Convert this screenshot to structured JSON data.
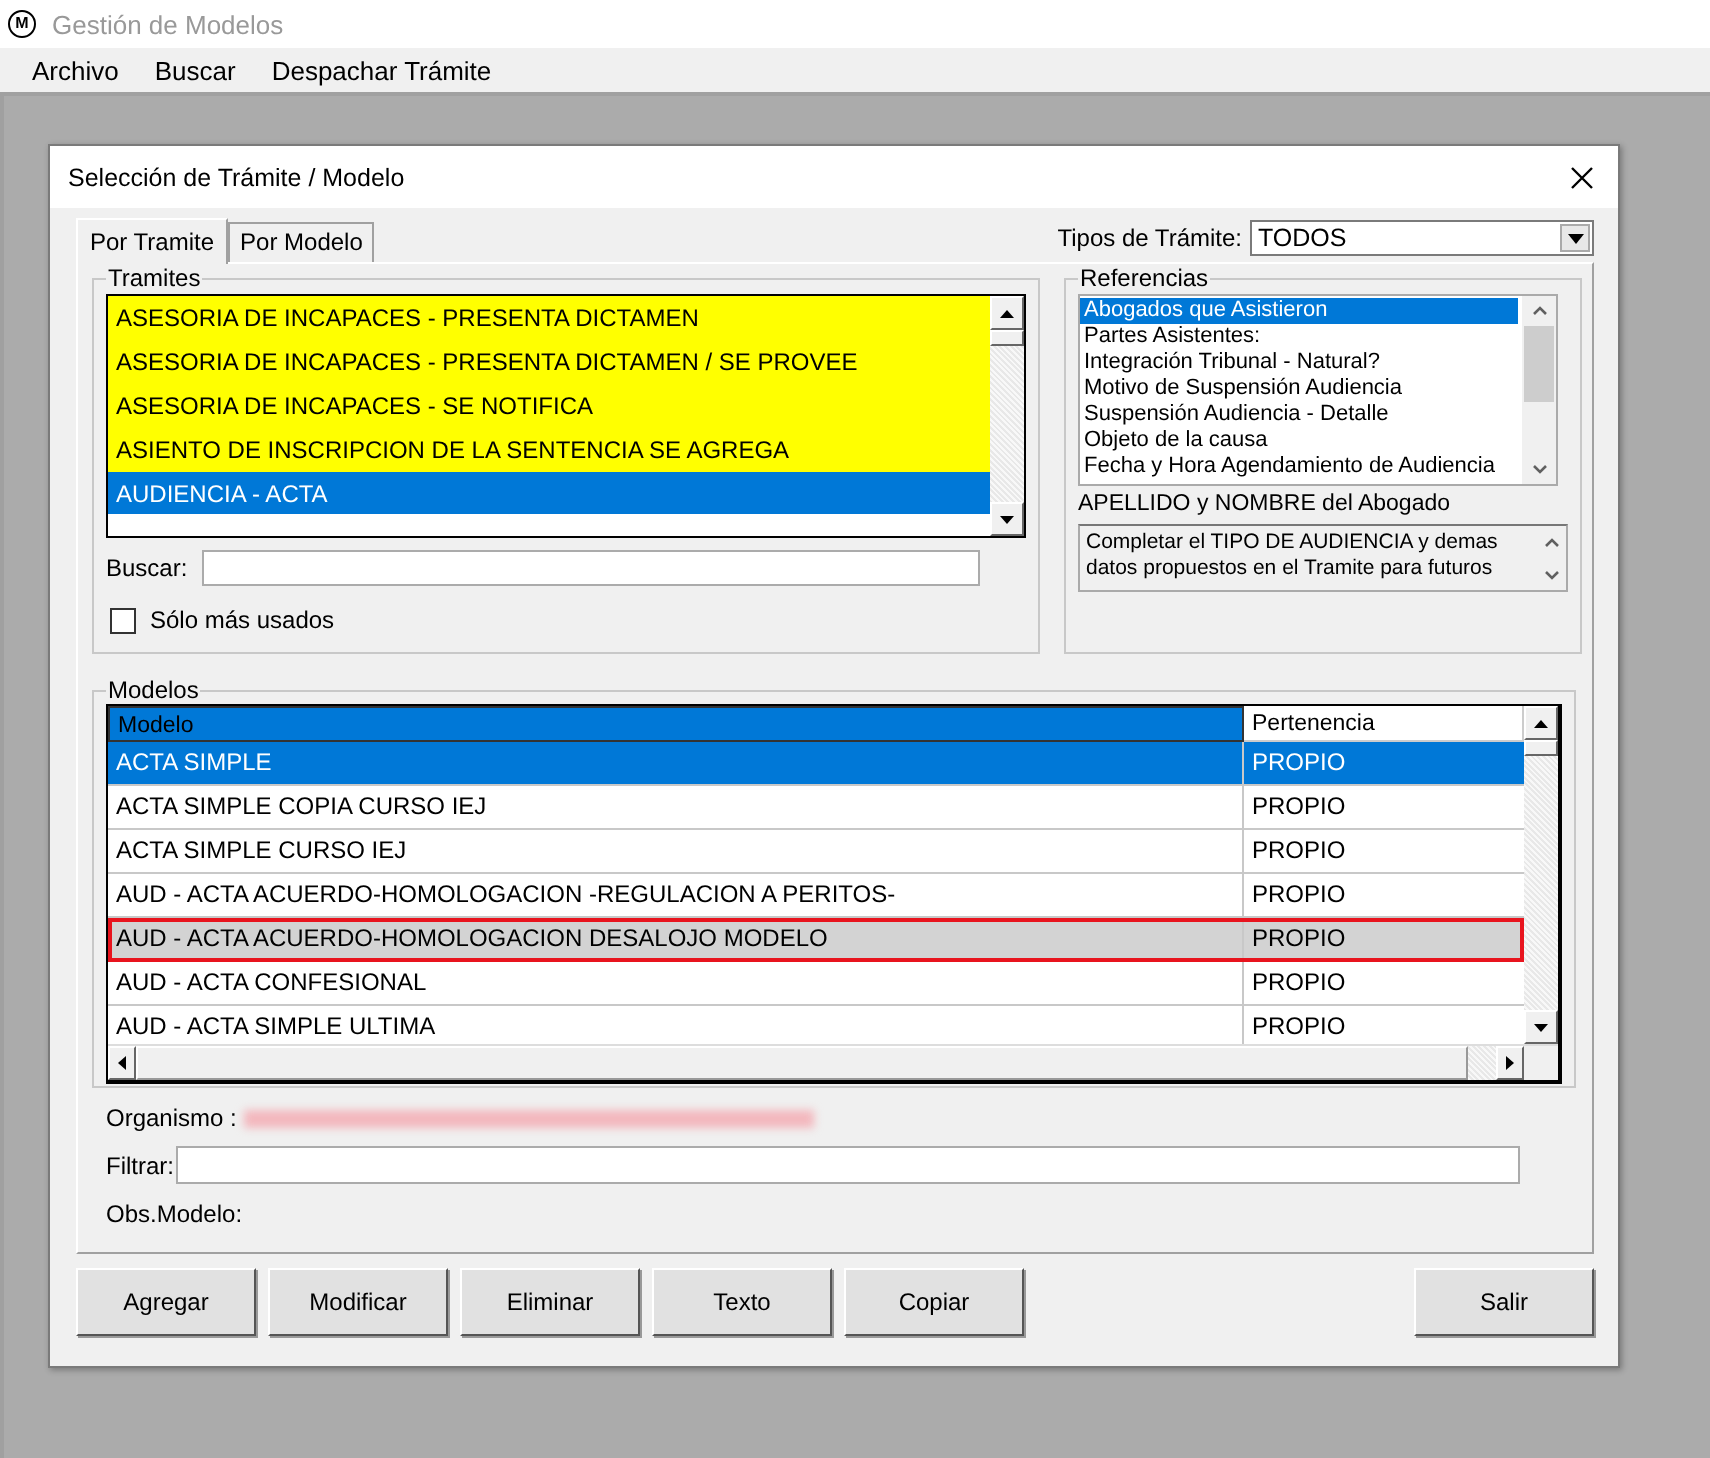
{
  "app": {
    "title": "Gestión de Modelos",
    "logo": "M"
  },
  "menu": [
    "Archivo",
    "Buscar",
    "Despachar Trámite"
  ],
  "dialog": {
    "title": "Selección de Trámite / Modelo"
  },
  "tabs": [
    {
      "label": "Por Tramite",
      "selected": true
    },
    {
      "label": "Por Modelo",
      "selected": false
    }
  ],
  "tipos": {
    "label": "Tipos de Trámite:",
    "value": "TODOS"
  },
  "tramites": {
    "title": "Tramites",
    "items": [
      {
        "label": "ASESORIA DE INCAPACES - PRESENTA DICTAMEN",
        "color": "#ffff00",
        "selected": false
      },
      {
        "label": "ASESORIA DE INCAPACES - PRESENTA DICTAMEN / SE PROVEE",
        "color": "#ffff00",
        "selected": false
      },
      {
        "label": "ASESORIA DE INCAPACES - SE NOTIFICA",
        "color": "#ffff00",
        "selected": false
      },
      {
        "label": "ASIENTO DE INSCRIPCION DE LA SENTENCIA SE AGREGA",
        "color": "#ffff00",
        "selected": false
      },
      {
        "label": "AUDIENCIA - ACTA",
        "color": "#ffffff",
        "selected": true
      }
    ],
    "search_label": "Buscar:",
    "only_used": {
      "label": "Sólo más usados",
      "checked": false
    }
  },
  "referencias": {
    "title": "Referencias",
    "items": [
      {
        "label": "Abogados que Asistieron",
        "selected": true
      },
      {
        "label": "Partes Asistentes:",
        "selected": false
      },
      {
        "label": "Integración Tribunal - Natural?",
        "selected": false
      },
      {
        "label": "Motivo de Suspensión Audiencia",
        "selected": false
      },
      {
        "label": "Suspensión Audiencia - Detalle",
        "selected": false
      },
      {
        "label": "Objeto de la causa",
        "selected": false
      },
      {
        "label": "Fecha y Hora Agendamiento de Audiencia",
        "selected": false
      }
    ],
    "field_label": "APELLIDO y NOMBRE del Abogado",
    "note_lines": [
      "Completar el TIPO DE AUDIENCIA y demas",
      "datos propuestos en el Tramite para futuros"
    ]
  },
  "modelos": {
    "title": "Modelos",
    "columns": [
      {
        "label": "Modelo",
        "selected": true
      },
      {
        "label": "Pertenencia",
        "selected": false
      }
    ],
    "rows": [
      {
        "cells": [
          "ACTA SIMPLE",
          "PROPIO"
        ],
        "selected": true,
        "marked": false
      },
      {
        "cells": [
          "ACTA SIMPLE COPIA CURSO IEJ",
          "PROPIO"
        ],
        "selected": false,
        "marked": false
      },
      {
        "cells": [
          "ACTA SIMPLE CURSO IEJ",
          "PROPIO"
        ],
        "selected": false,
        "marked": false
      },
      {
        "cells": [
          "AUD - ACTA ACUERDO-HOMOLOGACION -REGULACION A PERITOS-",
          "PROPIO"
        ],
        "selected": false,
        "marked": false
      },
      {
        "cells": [
          "AUD - ACTA ACUERDO-HOMOLOGACION DESALOJO MODELO",
          "PROPIO"
        ],
        "selected": false,
        "marked": true
      },
      {
        "cells": [
          "AUD - ACTA CONFESIONAL",
          "PROPIO"
        ],
        "selected": false,
        "marked": false
      },
      {
        "cells": [
          "AUD - ACTA SIMPLE ULTIMA",
          "PROPIO"
        ],
        "selected": false,
        "marked": false
      }
    ]
  },
  "organismo": {
    "label": "Organismo :",
    "redacted": true
  },
  "filtrar_label": "Filtrar:",
  "obs_label": "Obs.Modelo:",
  "buttons": [
    "Agregar",
    "Modificar",
    "Eliminar",
    "Texto",
    "Copiar"
  ],
  "exit_button": "Salir"
}
